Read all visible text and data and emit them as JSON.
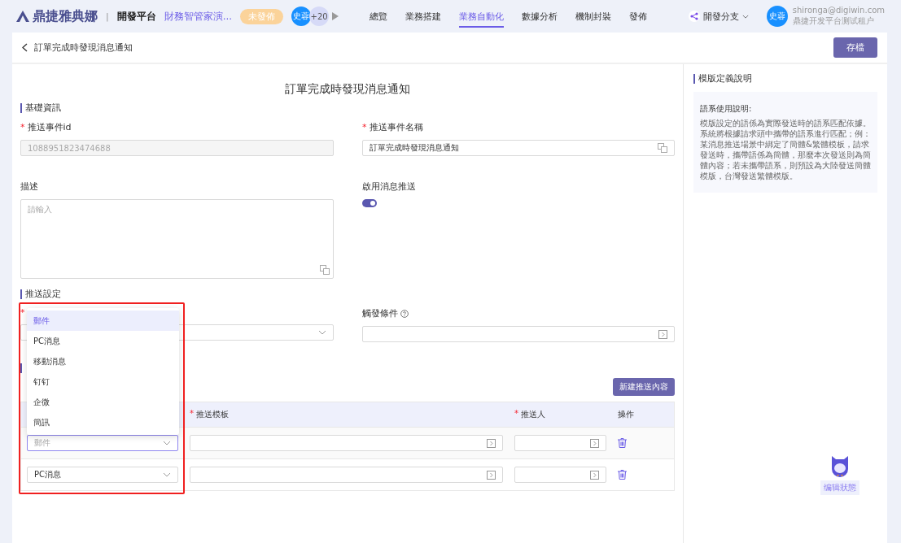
{
  "topbar": {
    "brand": "鼎捷雅典娜",
    "separator": "|",
    "platform": "開發平台",
    "app_name": "財務智管家演...",
    "status_badge": "未發佈",
    "collaborators": [
      "史蓉",
      "+20"
    ],
    "nav": [
      {
        "label": "總覽",
        "selected": false
      },
      {
        "label": "業務搭建",
        "selected": false
      },
      {
        "label": "業務自動化",
        "selected": true
      },
      {
        "label": "數據分析",
        "selected": false
      },
      {
        "label": "機制封裝",
        "selected": false
      },
      {
        "label": "發佈",
        "selected": false
      }
    ],
    "branch": "開發分支",
    "user": {
      "avatar": "史蓉",
      "email": "shironga@digiwin.com",
      "tenant": "鼎捷开发平台测试租户"
    }
  },
  "breadcrumb": "訂單完成時發現消息通知",
  "save_button": "存檔",
  "form": {
    "title": "訂單完成時發現消息通知",
    "basic": {
      "heading": "基礎資訊",
      "event_id": {
        "label": "推送事件id",
        "required_mark": "*",
        "value": "1088951823474688",
        "disabled": true
      },
      "event_name": {
        "label": "推送事件名稱",
        "required_mark": "*",
        "value": "訂單完成時發現消息通知"
      },
      "description": {
        "label": "描述",
        "placeholder": "請輸入"
      },
      "enable": {
        "label": "啟用消息推送",
        "on": true
      }
    },
    "push": {
      "heading": "推送設定",
      "required_mark": "*",
      "trigger_label": "觸發條件",
      "dropdown": [
        {
          "label": "郵件",
          "selected": true
        },
        {
          "label": "PC消息",
          "selected": false
        },
        {
          "label": "移動消息",
          "selected": false
        },
        {
          "label": "钉钉",
          "selected": false
        },
        {
          "label": "企微",
          "selected": false
        },
        {
          "label": "簡訊",
          "selected": false
        }
      ]
    },
    "content": {
      "new_button": "新建推送內容",
      "columns": [
        {
          "label": "推送模板",
          "required_mark": "*"
        },
        {
          "label": "推送人",
          "required_mark": "*"
        },
        {
          "label": "操作"
        }
      ],
      "rows": [
        {
          "type": "郵件",
          "focused": true
        },
        {
          "type": "PC消息",
          "focused": false
        }
      ]
    }
  },
  "side": {
    "heading": "模版定義說明",
    "note_title": "語系使用說明:",
    "note": "模版設定的語係為實際發送時的語系匹配依據。系統將根據請求頭中攜帶的語系進行匹配；例：某消息推送場景中綁定了簡體&繁體模板，請求發送時，攜帶語係為簡體，那麼本次發送則為簡體內容；若未攜帶語系，則預設為大陸發送簡體模版，台灣發送繁體模版。"
  },
  "assistant": {
    "label": "编辑狀態"
  }
}
